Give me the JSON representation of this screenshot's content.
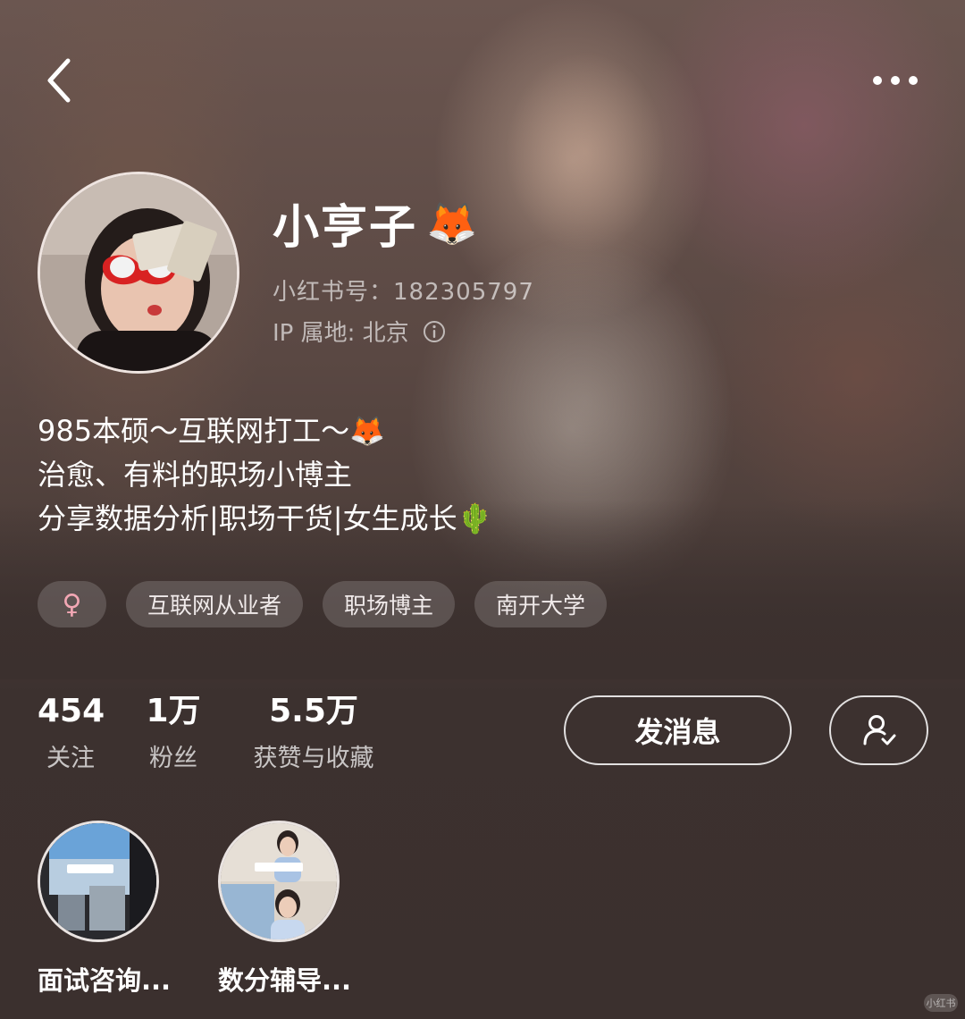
{
  "header": {
    "back_icon": "chevron-left-icon",
    "more_icon": "more-horizontal-icon"
  },
  "profile": {
    "name": "小亨子",
    "name_emoji": "🦊",
    "red_id": "小红书号：182305797",
    "ip_location": "IP 属地: 北京",
    "info_icon": "info-icon"
  },
  "bio": {
    "lines": [
      "985本硕～互联网打工～🦊",
      "治愈、有料的职场小博主",
      "分享数据分析|职场干货|女生成长🌵"
    ]
  },
  "tags": {
    "gender": "♀",
    "items": [
      "互联网从业者",
      "职场博主",
      "南开大学"
    ]
  },
  "stats": {
    "following": {
      "value": "454",
      "label": "关注"
    },
    "followers": {
      "value": "1万",
      "label": "粉丝"
    },
    "likes": {
      "value": "5.5万",
      "label": "获赞与收藏"
    }
  },
  "actions": {
    "message_label": "发消息",
    "follow_icon": "user-check-icon"
  },
  "collections": [
    {
      "label": "面试咨询..."
    },
    {
      "label": "数分辅导..."
    }
  ],
  "watermark": "小红书",
  "colors": {
    "background": "#3b302e",
    "gender_pink": "#f2a7b4",
    "tag_bg": "rgba(255,255,255,0.16)"
  }
}
